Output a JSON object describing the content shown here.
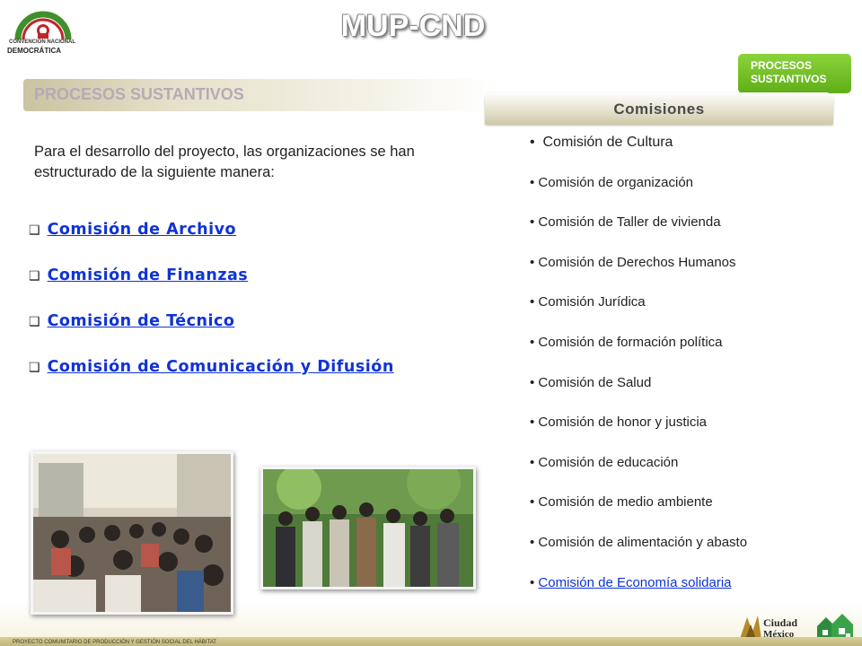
{
  "header": {
    "app_title": "MUP-CND",
    "logo_text_line1": "CONVENCIÓN NACIONAL",
    "logo_text_line2": "DEMOCRÁTICA",
    "badge_line1": "PROCESOS",
    "badge_line2": "SUSTANTIVOS"
  },
  "section": {
    "title": "PROCESOS SUSTANTIVOS",
    "tab_label": "Comisiones"
  },
  "intro_text": "Para el desarrollo del proyecto, las organizaciones se han estructurado de la siguiente manera:",
  "links": [
    "Comisión de Archivo",
    "Comisión de Finanzas",
    "Comisión de Técnico",
    "Comisión de Comunicación y Difusión"
  ],
  "comisiones": [
    "Comisión de Cultura",
    "Comisión de organización",
    "Comisión de Taller de vivienda",
    "Comisión de Derechos Humanos",
    "Comisión Jurídica",
    "Comisión de formación política",
    "Comisión de Salud",
    "Comisión de honor y justicia",
    "Comisión de educación",
    "Comisión de medio ambiente",
    "Comisión de alimentación y abasto",
    "Comisión de Economía solidaria"
  ],
  "footer_text": "PROYECTO COMUNITARIO DE PRODUCCIÓN Y GESTIÓN SOCIAL DEL HÁBITAT",
  "colors": {
    "link": "#1033d6",
    "badge_green": "#6fbf22",
    "header_tan": "#c9c3a0"
  }
}
